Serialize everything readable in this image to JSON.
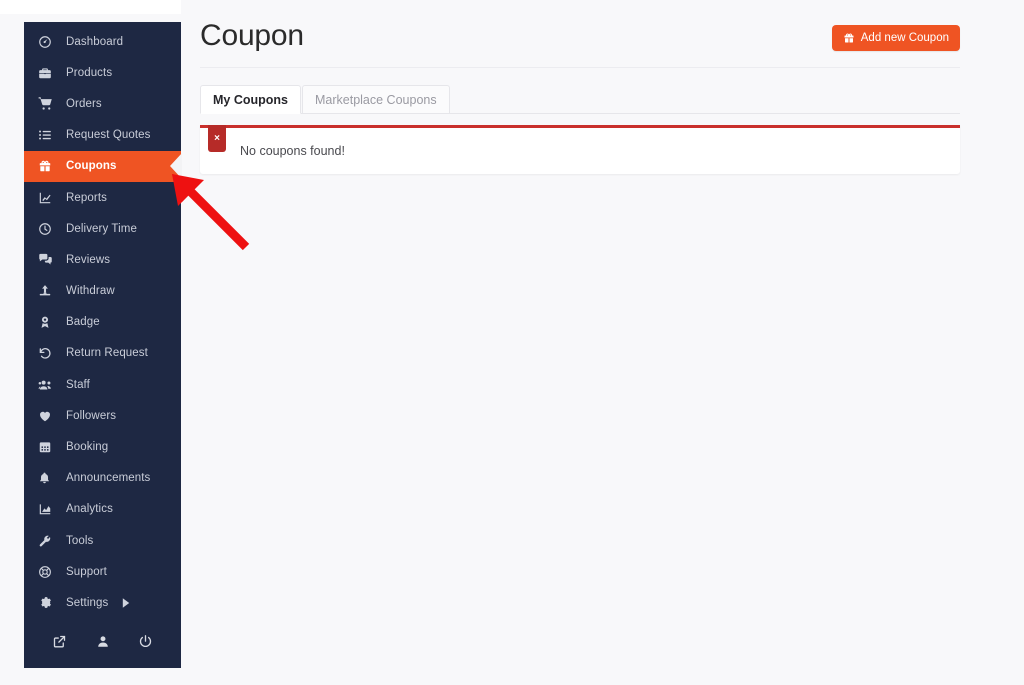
{
  "sidebar": {
    "items": [
      {
        "label": "Dashboard",
        "icon": "dashboard-gauge-icon",
        "active": false,
        "caret": false
      },
      {
        "label": "Products",
        "icon": "briefcase-icon",
        "active": false,
        "caret": false
      },
      {
        "label": "Orders",
        "icon": "shopping-cart-icon",
        "active": false,
        "caret": false
      },
      {
        "label": "Request Quotes",
        "icon": "list-icon",
        "active": false,
        "caret": false
      },
      {
        "label": "Coupons",
        "icon": "gift-icon",
        "active": true,
        "caret": false
      },
      {
        "label": "Reports",
        "icon": "chart-line-icon",
        "active": false,
        "caret": false
      },
      {
        "label": "Delivery Time",
        "icon": "clock-icon",
        "active": false,
        "caret": false
      },
      {
        "label": "Reviews",
        "icon": "comments-icon",
        "active": false,
        "caret": false
      },
      {
        "label": "Withdraw",
        "icon": "upload-icon",
        "active": false,
        "caret": false
      },
      {
        "label": "Badge",
        "icon": "award-badge-icon",
        "active": false,
        "caret": false
      },
      {
        "label": "Return Request",
        "icon": "undo-arrow-icon",
        "active": false,
        "caret": false
      },
      {
        "label": "Staff",
        "icon": "users-icon",
        "active": false,
        "caret": false
      },
      {
        "label": "Followers",
        "icon": "heart-icon",
        "active": false,
        "caret": false
      },
      {
        "label": "Booking",
        "icon": "calendar-icon",
        "active": false,
        "caret": false
      },
      {
        "label": "Announcements",
        "icon": "bell-icon",
        "active": false,
        "caret": false
      },
      {
        "label": "Analytics",
        "icon": "chart-area-icon",
        "active": false,
        "caret": false
      },
      {
        "label": "Tools",
        "icon": "wrench-icon",
        "active": false,
        "caret": false
      },
      {
        "label": "Support",
        "icon": "life-ring-icon",
        "active": false,
        "caret": false
      },
      {
        "label": "Settings",
        "icon": "gear-icon",
        "active": false,
        "caret": true
      }
    ],
    "footer": [
      {
        "icon": "external-link-icon"
      },
      {
        "icon": "user-icon"
      },
      {
        "icon": "power-off-icon"
      }
    ],
    "colors": {
      "background": "#1e2843",
      "active_background": "#ef5423",
      "label": "#c9cdd8",
      "active_label": "#ffffff"
    }
  },
  "header": {
    "title": "Coupon",
    "add_button": {
      "label": "Add new Coupon",
      "icon": "gift-icon",
      "color": "#ef5423"
    }
  },
  "tabs": [
    {
      "label": "My Coupons",
      "active": true
    },
    {
      "label": "Marketplace Coupons",
      "active": false
    }
  ],
  "alert": {
    "message": "No coupons found!",
    "close_label": "×",
    "border_color": "#c9302c",
    "close_background": "#b62b28"
  },
  "annotation": {
    "type": "arrow",
    "color": "#ee1111",
    "points_to": "sidebar-item-coupons"
  }
}
